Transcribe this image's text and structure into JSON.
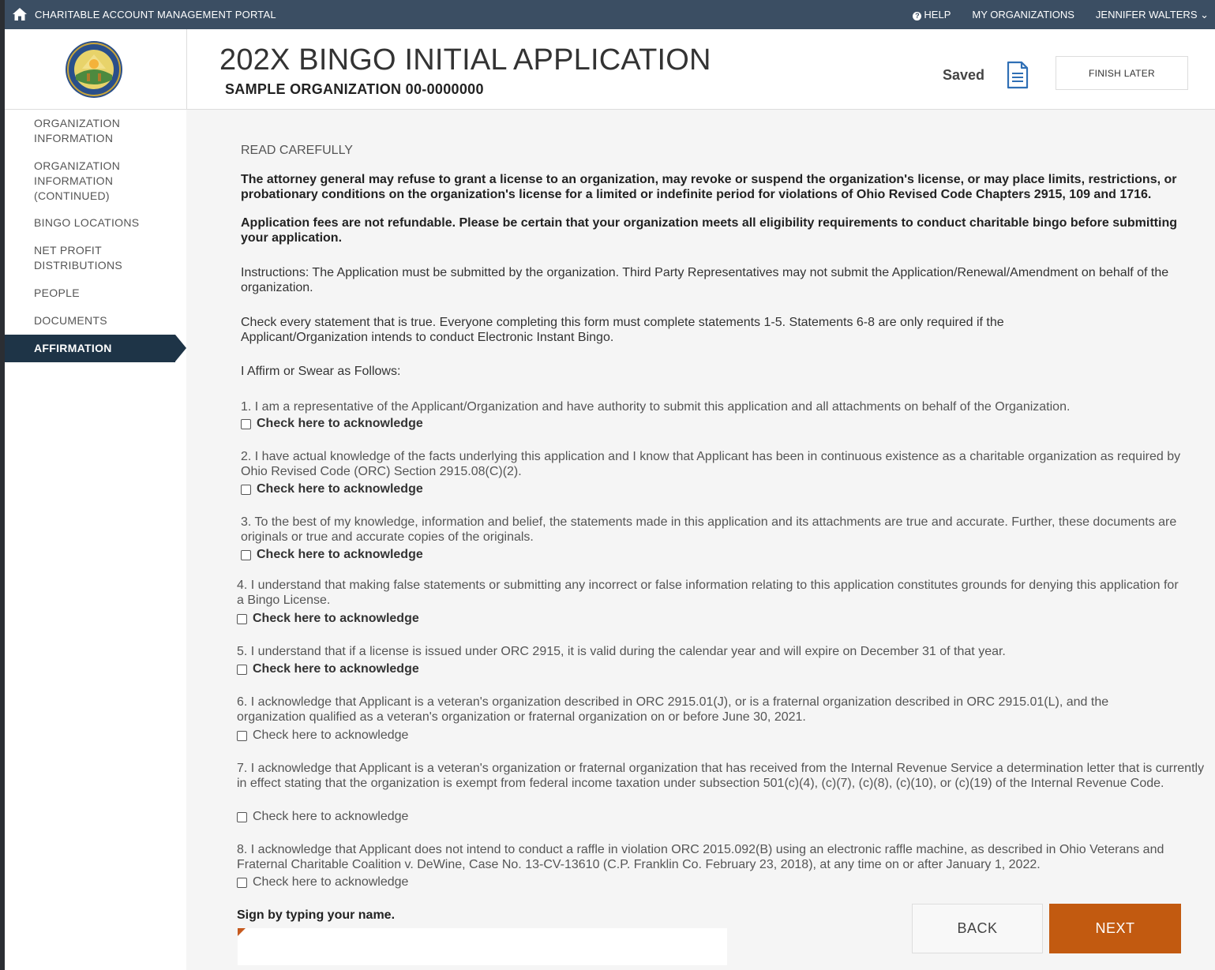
{
  "topbar": {
    "portal_title": "CHARITABLE ACCOUNT MANAGEMENT PORTAL",
    "help": "HELP",
    "my_organizations": "MY ORGANIZATIONS",
    "user": "JENNIFER WALTERS ⌄"
  },
  "header": {
    "title": "202X BINGO INITIAL APPLICATION",
    "organization": "SAMPLE ORGANIZATION 00-0000000",
    "saved_label": "Saved",
    "finish_later": "FINISH LATER"
  },
  "sidebar": {
    "items": [
      "ORGANIZATION INFORMATION",
      "ORGANIZATION INFORMATION (CONTINUED)",
      "BINGO LOCATIONS",
      "NET PROFIT DISTRIBUTIONS",
      "PEOPLE",
      "DOCUMENTS"
    ],
    "active": "AFFIRMATION"
  },
  "content": {
    "read_carefully": "READ CAREFULLY",
    "para1": "The attorney general may refuse to grant a license to an organization, may revoke or suspend the organization's license, or may place limits, restrictions, or probationary conditions on the organization's license for a limited or indefinite period for violations of Ohio Revised Code Chapters 2915, 109 and 1716.",
    "para2": "Application fees are not refundable. Please be certain that your organization meets all eligibility requirements to conduct charitable bingo before submitting your application.",
    "para3": "Instructions: The Application must be submitted by the organization. Third Party Representatives may not submit the Application/Renewal/Amendment on behalf of the organization.",
    "para4": "Check every statement that is true. Everyone completing this form must complete statements 1-5. Statements 6-8 are only required if the Applicant/Organization intends to conduct Electronic Instant Bingo.",
    "affirm": "I Affirm or Swear as Follows:",
    "ack_label": "Check here to acknowledge",
    "statements": [
      "1. I am a representative of the Applicant/Organization and have authority to submit this application and all attachments on behalf of the Organization.",
      "2. I have actual knowledge of the facts underlying this application and I know that Applicant has been in continuous existence as a charitable organization as required by Ohio Revised Code (ORC) Section 2915.08(C)(2).",
      "3. To the best of my knowledge, information and belief, the statements made in this application and its attachments are true and accurate.  Further, these documents are originals or true and accurate copies of the originals.",
      "4. I understand that making false statements or submitting any incorrect or false information relating to this application constitutes grounds for denying this application for a Bingo License.",
      "5. I understand that if a license is issued under ORC 2915, it is valid during the calendar year and will expire on December 31 of that year.",
      "6. I acknowledge that Applicant is a veteran's organization described in ORC 2915.01(J), or is a fraternal organization described in ORC 2915.01(L), and the organization qualified as a veteran's organization or fraternal organization on or before June 30, 2021.",
      "7. I acknowledge that Applicant is a veteran's organization or fraternal organization that has received from the Internal Revenue Service a determination letter that is currently in effect stating that the organization is exempt from federal income taxation under subsection 501(c)(4), (c)(7), (c)(8), (c)(10), or (c)(19) of the Internal Revenue Code.",
      "8. I acknowledge that Applicant does not intend to conduct a raffle in violation ORC 2015.092(B) using an electronic raffle machine, as described in Ohio Veterans and Fraternal Charitable Coalition v. DeWine, Case No. 13-CV-13610 (C.P. Franklin Co. February 23, 2018), at any time on or after January 1, 2022."
    ],
    "sign_label": "Sign by typing your name.",
    "sign_value": "",
    "back": "BACK",
    "next": "NEXT"
  },
  "colors": {
    "topbar": "#3b4e63",
    "active_nav": "#1e3447",
    "next_button": "#c25a10",
    "required_marker": "#c65a1e"
  }
}
